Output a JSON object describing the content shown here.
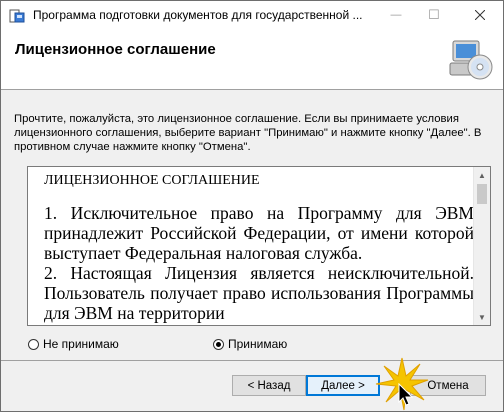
{
  "window": {
    "title": "Программа подготовки документов для государственной ...",
    "minimize_glyph": "—",
    "maximize_glyph": "☐"
  },
  "header": {
    "title": "Лицензионное соглашение",
    "icon": "computer-disc-icon"
  },
  "instructions": "Прочтите, пожалуйста, это лицензионное соглашение. Если вы принимаете условия лицензионного соглашения, выберите вариант \"Принимаю\" и нажмите кнопку \"Далее\". В противном случае нажмите кнопку \"Отмена\".",
  "license": {
    "heading": "ЛИЦЕНЗИОННОЕ СОГЛАШЕНИЕ",
    "paragraphs": [
      "1. Исключительное право на Программу для ЭВМ принадлежит Российской Федерации, от имени которой выступает Федеральная налоговая служба.",
      "2. Настоящая Лицензия является неисключительной. Пользователь получает право использования Программы для ЭВМ на территории"
    ]
  },
  "options": {
    "decline_label": "Не принимаю",
    "accept_label": "Принимаю",
    "selected": "accept"
  },
  "buttons": {
    "back": "< Назад",
    "next": "Далее >",
    "cancel": "Отмена"
  },
  "colors": {
    "accent": "#0078d7",
    "cursor_highlight": "#f5c400"
  }
}
